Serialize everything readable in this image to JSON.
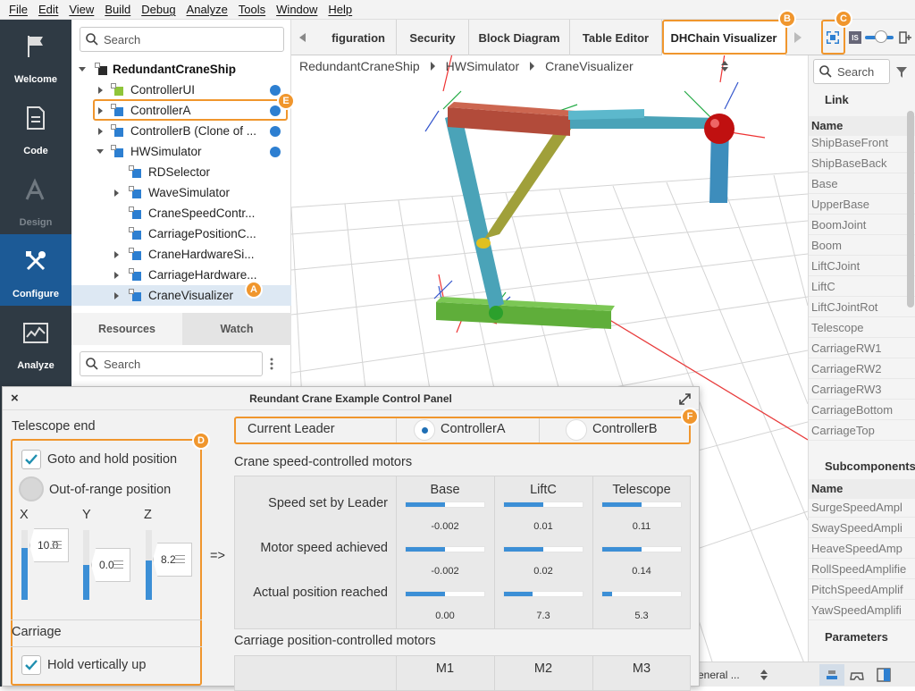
{
  "menubar": {
    "items": [
      "File",
      "Edit",
      "View",
      "Build",
      "Debug",
      "Analyze",
      "Tools",
      "Window",
      "Help"
    ]
  },
  "leftnav": {
    "items": [
      {
        "label": "Welcome",
        "icon": "flag-icon",
        "state": "normal"
      },
      {
        "label": "Code",
        "icon": "document-icon",
        "state": "normal"
      },
      {
        "label": "Design",
        "icon": "design-icon",
        "state": "disabled"
      },
      {
        "label": "Configure",
        "icon": "wrench-screwdriver-icon",
        "state": "active"
      },
      {
        "label": "Analyze",
        "icon": "chart-icon",
        "state": "normal"
      }
    ]
  },
  "tree": {
    "search_placeholder": "Search",
    "root": "RedundantCraneShip",
    "items": [
      {
        "label": "ControllerUI",
        "link": true
      },
      {
        "label": "ControllerA",
        "link": true
      },
      {
        "label": "ControllerB (Clone of ...",
        "link": true
      },
      {
        "label": "HWSimulator",
        "link": true
      },
      {
        "label": "RDSelector"
      },
      {
        "label": "WaveSimulator"
      },
      {
        "label": "CraneSpeedContr..."
      },
      {
        "label": "CarriagePositionC..."
      },
      {
        "label": "CraneHardwareSi..."
      },
      {
        "label": "CarriageHardware..."
      },
      {
        "label": "CraneVisualizer",
        "selected": true
      }
    ]
  },
  "bottom_tabs": {
    "resources": "Resources",
    "watch": "Watch",
    "search_placeholder": "Search"
  },
  "tabs": [
    "figuration",
    "Security",
    "Block Diagram",
    "Table Editor",
    "DHChain Visualizer"
  ],
  "toolbar": {
    "is_label": "IS"
  },
  "breadcrumb": [
    "RedundantCraneShip",
    "HWSimulator",
    "CraneVisualizer"
  ],
  "right_panel": {
    "search_placeholder": "Search",
    "link_header": "Link",
    "name_header": "Name",
    "links": [
      "ShipBaseFront",
      "ShipBaseBack",
      "Base",
      "UpperBase",
      "BoomJoint",
      "Boom",
      "LiftCJoint",
      "LiftC",
      "LiftCJointRot",
      "Telescope",
      "CarriageRW1",
      "CarriageRW2",
      "CarriageRW3",
      "CarriageBottom",
      "CarriageTop"
    ],
    "subcomponents_header": "Subcomponents",
    "subcomponents": [
      "SurgeSpeedAmpl",
      "SwaySpeedAmpli",
      "HeaveSpeedAmp",
      "RollSpeedAmplifie",
      "PitchSpeedAmplif",
      "YawSpeedAmplifi"
    ],
    "parameters_header": "Parameters",
    "status_text": "eneral ..."
  },
  "panel": {
    "title": "Reundant Crane Example Control Panel",
    "close": "×",
    "telescope_end": "Telescope end",
    "goto_hold": "Goto and hold position",
    "goto_hold_checked": true,
    "out_of_range": "Out-of-range position",
    "axes": [
      {
        "label": "X",
        "value": "10.0",
        "fill": 0.75
      },
      {
        "label": "Y",
        "value": "0.0",
        "fill": 0.5
      },
      {
        "label": "Z",
        "value": "8.2",
        "fill": 0.57
      }
    ],
    "arrow": "=>",
    "carriage": "Carriage",
    "hold_vertical": "Hold vertically up",
    "hold_vertical_checked": true,
    "current_leader": "Current Leader",
    "leader_options": [
      "ControllerA",
      "ControllerB"
    ],
    "leader_selected": "ControllerA",
    "speed_section": "Crane speed-controlled motors",
    "columns": [
      "Base",
      "LiftC",
      "Telescope"
    ],
    "rows": [
      {
        "label": "Speed set by Leader",
        "values": [
          "-0.002",
          "0.01",
          "0.11"
        ],
        "fills": [
          0.5,
          0.5,
          0.5
        ]
      },
      {
        "label": "Motor speed achieved",
        "values": [
          "-0.002",
          "0.02",
          "0.14"
        ],
        "fills": [
          0.5,
          0.5,
          0.5
        ]
      },
      {
        "label": "Actual position reached",
        "values": [
          "0.00",
          "7.3",
          "5.3"
        ],
        "fills": [
          0.5,
          0.36,
          0.12
        ]
      }
    ],
    "carriage_section": "Carriage position-controlled motors",
    "carriage_columns": [
      "M1",
      "M2",
      "M3"
    ]
  },
  "callouts": [
    "A",
    "B",
    "C",
    "D",
    "E",
    "F"
  ],
  "colors": {
    "accent": "#f0962d",
    "nav_bg": "#2f3a44",
    "nav_active": "#1c5a96",
    "bar": "#3c8fd6"
  }
}
